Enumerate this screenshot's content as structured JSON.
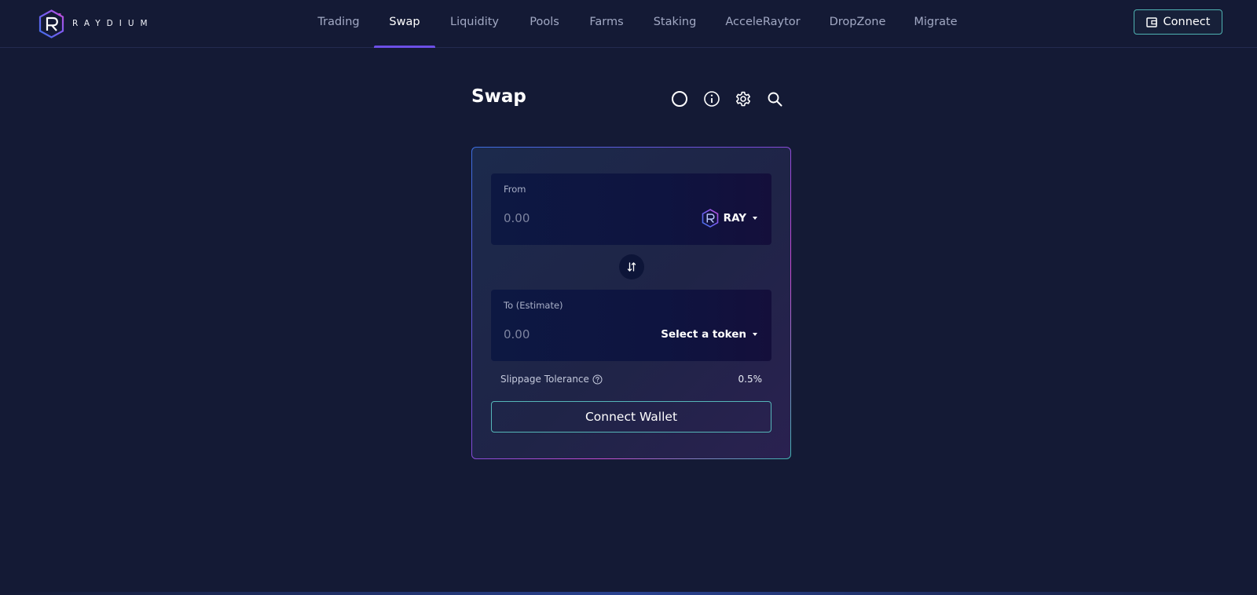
{
  "header": {
    "brand": "RAYDIUM",
    "nav": [
      {
        "label": "Trading",
        "active": false
      },
      {
        "label": "Swap",
        "active": true
      },
      {
        "label": "Liquidity",
        "active": false
      },
      {
        "label": "Pools",
        "active": false
      },
      {
        "label": "Farms",
        "active": false
      },
      {
        "label": "Staking",
        "active": false
      },
      {
        "label": "AcceleRaytor",
        "active": false
      },
      {
        "label": "DropZone",
        "active": false
      },
      {
        "label": "Migrate",
        "active": false
      }
    ],
    "connect_label": "Connect",
    "connect_icon": "wallet-icon"
  },
  "page": {
    "title": "Swap",
    "tools": [
      "refresh-icon",
      "info-icon",
      "gear-icon",
      "search-icon"
    ]
  },
  "swap": {
    "from": {
      "label": "From",
      "placeholder": "0.00",
      "value": "",
      "token": "RAY",
      "token_icon": "ray-token-icon"
    },
    "switch_icon": "swap-arrows-icon",
    "to": {
      "label": "To (Estimate)",
      "placeholder": "0.00",
      "value": "",
      "token": "Select a token"
    },
    "slippage": {
      "label": "Slippage Tolerance",
      "value": "0.5%"
    },
    "action_label": "Connect Wallet"
  },
  "colors": {
    "background": "#141a35",
    "nav_active_underline": "#6c4fe6",
    "button_border": "#55b6b9",
    "brand_accent": "#8a4fe0"
  }
}
